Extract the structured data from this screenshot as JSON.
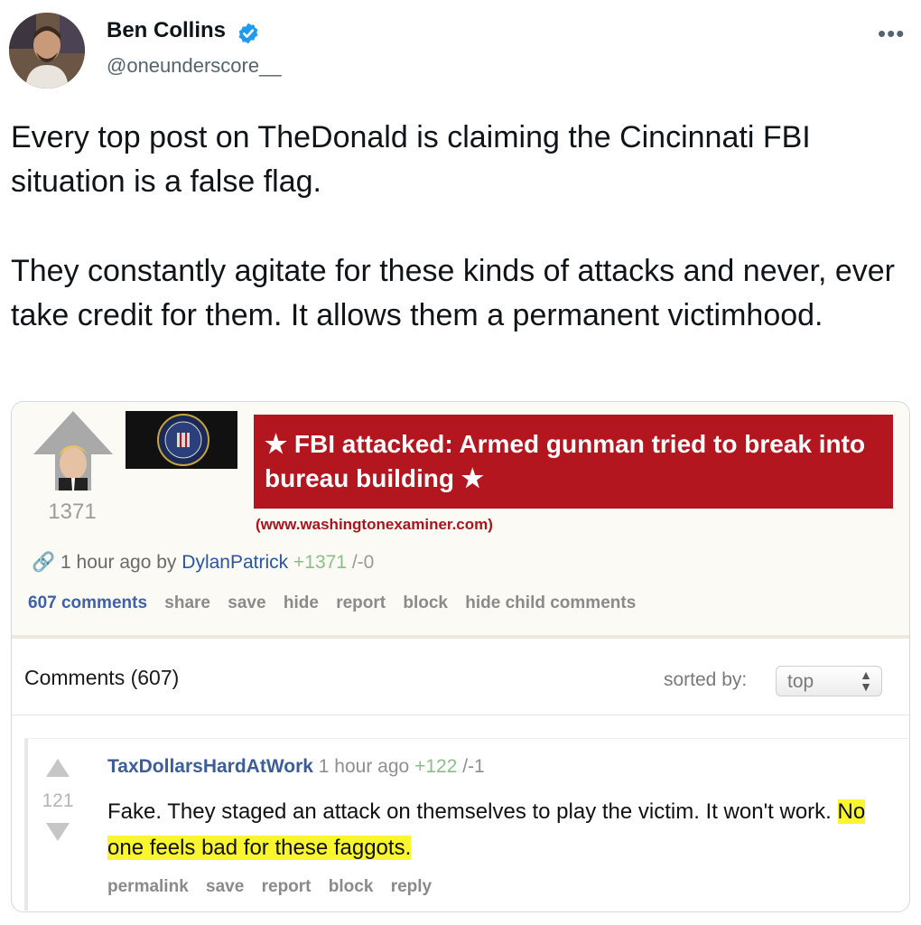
{
  "tweet": {
    "author_name": "Ben Collins",
    "handle": "@oneunderscore__",
    "more_icon": "more-horizontal-icon",
    "paragraph1": "Every top post on TheDonald is claiming the Cincinnati FBI situation is a false flag.",
    "paragraph2": "They constantly agitate for these kinds of attacks and never, ever take credit for them. It allows them a permanent victimhood."
  },
  "post": {
    "score": "1371",
    "title": "★ FBI attacked: Armed gunman tried to break into bureau building ★",
    "domain": "(www.washingtonexaminer.com)",
    "time": "1 hour ago by",
    "author": "DylanPatrick",
    "up": "+1371",
    "sep": "/",
    "down": "-0",
    "actions": {
      "comments": "607 comments",
      "share": "share",
      "save": "save",
      "hide": "hide",
      "report": "report",
      "block": "block",
      "hide_child": "hide child comments"
    }
  },
  "comments_section": {
    "header": "Comments (607)",
    "sorted_label": "sorted by:",
    "sort_value": "top"
  },
  "comment": {
    "author": "TaxDollarsHardAtWork",
    "time": "1 hour ago",
    "up": "+122",
    "sep": "/",
    "down": "-1",
    "score": "121",
    "text_plain": "Fake. They staged an attack on themselves to play the victim. It won't work.",
    "text_highlighted": "No one feels bad for these faggots.",
    "actions": {
      "permalink": "permalink",
      "save": "save",
      "report": "report",
      "block": "block",
      "reply": "reply"
    }
  },
  "colors": {
    "headline_bg": "#b3161e",
    "highlight": "#f9f630",
    "verified": "#1d9bf0"
  }
}
